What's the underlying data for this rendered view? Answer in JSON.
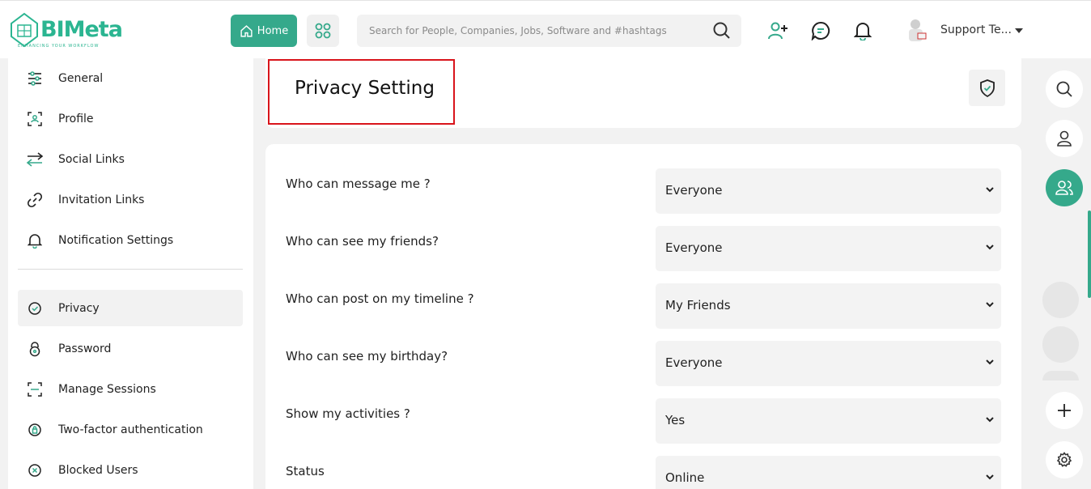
{
  "header": {
    "logo_text": "BIMeta",
    "logo_tagline": "ENHANCING YOUR WORKFLOW",
    "home_label": "Home",
    "search_placeholder": "Search for People, Companies, Jobs, Software and #hashtags",
    "user_name": "Support Te..."
  },
  "sidebar": {
    "items": [
      {
        "label": "General",
        "icon": "sliders-icon"
      },
      {
        "label": "Profile",
        "icon": "profile-scan-icon"
      },
      {
        "label": "Social Links",
        "icon": "arrows-exchange-icon"
      },
      {
        "label": "Invitation Links",
        "icon": "link-icon"
      },
      {
        "label": "Notification Settings",
        "icon": "bell-icon"
      },
      {
        "label": "Privacy",
        "icon": "shield-check-icon",
        "active": true
      },
      {
        "label": "Password",
        "icon": "lock-icon"
      },
      {
        "label": "Manage Sessions",
        "icon": "scan-icon"
      },
      {
        "label": "Two-factor authentication",
        "icon": "key-shield-icon"
      },
      {
        "label": "Blocked Users",
        "icon": "block-icon"
      }
    ]
  },
  "page": {
    "title": "Privacy Setting"
  },
  "form": {
    "rows": [
      {
        "label": "Who can message me ?",
        "value": "Everyone"
      },
      {
        "label": "Who can see my friends?",
        "value": "Everyone"
      },
      {
        "label": "Who can post on my timeline ?",
        "value": "My Friends"
      },
      {
        "label": "Who can see my birthday?",
        "value": "Everyone"
      },
      {
        "label": "Show my activities ?",
        "value": "Yes"
      },
      {
        "label": "Status",
        "value": "Online"
      }
    ]
  },
  "colors": {
    "accent": "#35a98b",
    "highlight_border": "#d9141b"
  }
}
